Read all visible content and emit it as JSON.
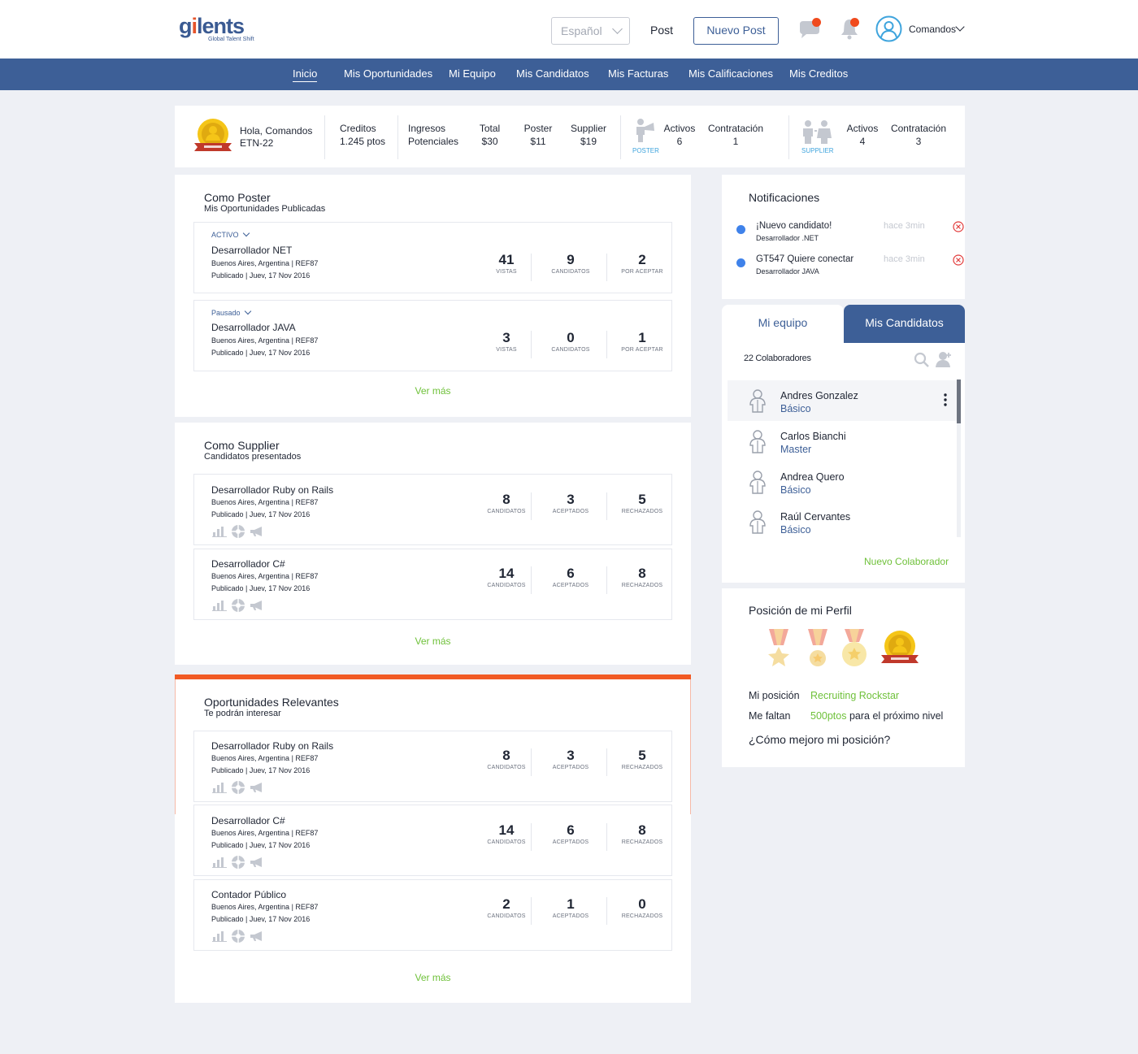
{
  "header": {
    "logo_text_main": "g",
    "logo_text_rest": "lents",
    "logo_tagline": "Global Talent Shift",
    "language": "Español",
    "post_link": "Post",
    "new_post": "Nuevo Post",
    "user_name": "Comandos"
  },
  "nav": {
    "items": [
      "Inicio",
      "Mis Oportunidades",
      "Mi Equipo",
      "Mis Candidatos",
      "Mis Facturas",
      "Mis Calificaciones",
      "Mis Creditos"
    ],
    "active": "Inicio"
  },
  "stats": {
    "greeting": "Hola, Comandos",
    "user_code": "ETN-22",
    "credits_label": "Creditos",
    "credits_value": "1.245 ptos",
    "income_label_1": "Ingresos",
    "income_label_2": "Potenciales",
    "total_label": "Total",
    "total_value": "$30",
    "poster_label": "Poster",
    "poster_value": "$11",
    "supplier_label": "Supplier",
    "supplier_value": "$19",
    "poster_role": "POSTER",
    "poster_activos_label": "Activos",
    "poster_activos_value": "6",
    "poster_contr_label": "Contratación",
    "poster_contr_value": "1",
    "supplier_role": "SUPPLIER",
    "supplier_activos_label": "Activos",
    "supplier_activos_value": "4",
    "supplier_contr_label": "Contratación",
    "supplier_contr_value": "3"
  },
  "poster": {
    "title": "Como Poster",
    "subtitle": "Mis Oportunidades Publicadas",
    "jobs": [
      {
        "status": "ACTIVO",
        "title": "Desarrollador NET",
        "location": "Buenos Aires, Argentina | REF87",
        "published": "Publicado | Juev, 17 Nov 2016",
        "m1": "41",
        "l1": "VISTAS",
        "m2": "9",
        "l2": "CANDIDATOS",
        "m3": "2",
        "l3": "POR ACEPTAR"
      },
      {
        "status": "Pausado",
        "title": "Desarrollador JAVA",
        "location": "Buenos Aires, Argentina | REF87",
        "published": "Publicado | Juev, 17 Nov 2016",
        "m1": "3",
        "l1": "VISTAS",
        "m2": "0",
        "l2": "CANDIDATOS",
        "m3": "1",
        "l3": "POR ACEPTAR"
      }
    ],
    "more": "Ver más"
  },
  "supplier": {
    "title": "Como Supplier",
    "subtitle": "Candidatos presentados",
    "jobs": [
      {
        "title": "Desarrollador Ruby on Rails",
        "location": "Buenos Aires, Argentina | REF87",
        "published": "Publicado | Juev, 17 Nov 2016",
        "m1": "8",
        "l1": "CANDIDATOS",
        "m2": "3",
        "l2": "ACEPTADOS",
        "m3": "5",
        "l3": "RECHAZADOS"
      },
      {
        "title": "Desarrollador C#",
        "location": "Buenos Aires, Argentina | REF87",
        "published": "Publicado | Juev, 17 Nov 2016",
        "m1": "14",
        "l1": "CANDIDATOS",
        "m2": "6",
        "l2": "ACEPTADOS",
        "m3": "8",
        "l3": "RECHAZADOS"
      }
    ],
    "more": "Ver más"
  },
  "relevant": {
    "title": "Oportunidades Relevantes",
    "subtitle": "Te podrán interesar",
    "jobs": [
      {
        "title": "Desarrollador Ruby on Rails",
        "location": "Buenos Aires, Argentina | REF87",
        "published": "Publicado | Juev, 17 Nov 2016",
        "m1": "8",
        "l1": "CANDIDATOS",
        "m2": "3",
        "l2": "ACEPTADOS",
        "m3": "5",
        "l3": "RECHAZADOS"
      },
      {
        "title": "Desarrollador C#",
        "location": "Buenos Aires, Argentina | REF87",
        "published": "Publicado | Juev, 17 Nov 2016",
        "m1": "14",
        "l1": "CANDIDATOS",
        "m2": "6",
        "l2": "ACEPTADOS",
        "m3": "8",
        "l3": "RECHAZADOS"
      },
      {
        "title": "Contador Público",
        "location": "Buenos Aires, Argentina | REF87",
        "published": "Publicado | Juev, 17 Nov 2016",
        "m1": "2",
        "l1": "CANDIDATOS",
        "m2": "1",
        "l2": "ACEPTADOS",
        "m3": "0",
        "l3": "RECHAZADOS"
      }
    ],
    "more": "Ver más"
  },
  "notifications": {
    "title": "Notificaciones",
    "items": [
      {
        "title": "¡Nuevo candidato!",
        "sub": "Desarrollador .NET",
        "time": "hace 3min"
      },
      {
        "title": "GT547 Quiere conectar",
        "sub": "Desarrollador JAVA",
        "time": "hace 3min"
      }
    ]
  },
  "team": {
    "tab_team": "Mi equipo",
    "tab_candidates": "Mis Candidatos",
    "count": "22 Colaboradores",
    "members": [
      {
        "name": "Andres Gonzalez",
        "level": "Básico"
      },
      {
        "name": "Carlos Bianchi",
        "level": "Master"
      },
      {
        "name": "Andrea Quero",
        "level": "Básico"
      },
      {
        "name": "Raúl Cervantes",
        "level": "Básico"
      }
    ],
    "new_member": "Nuevo Colaborador"
  },
  "profile": {
    "title": "Posición de mi Perfil",
    "position_label": "Mi posición",
    "position_value": "Recruiting Rockstar",
    "missing_label": "Me faltan",
    "missing_value": "500ptos",
    "missing_suffix": "para el próximo nivel",
    "how_improve": "¿Cómo mejoro mi posición?"
  },
  "colors": {
    "brand_blue": "#3d5f97",
    "accent_orange": "#f15a24",
    "green": "#6fc13a",
    "notif_blue": "#3f82ea"
  }
}
